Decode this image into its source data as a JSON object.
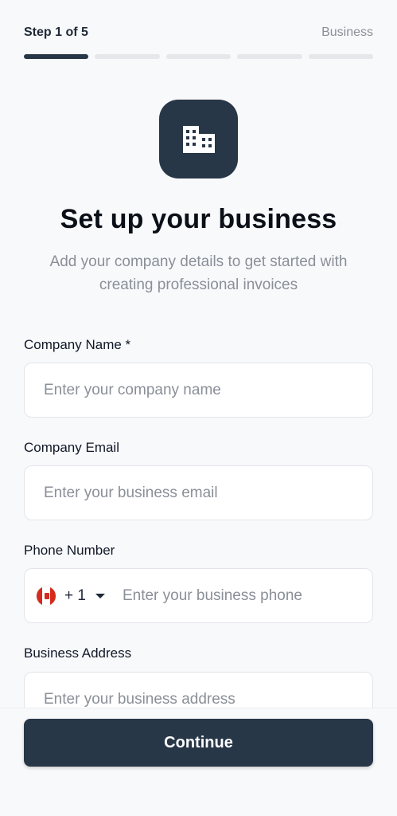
{
  "header": {
    "step_label": "Step 1 of 5",
    "step_name": "Business",
    "progress": {
      "current": 1,
      "total": 5
    }
  },
  "hero": {
    "icon": "building-icon",
    "title": "Set up your business",
    "subtitle": "Add your company details to get started with creating professional invoices"
  },
  "form": {
    "company_name": {
      "label": "Company Name *",
      "placeholder": "Enter your company name"
    },
    "company_email": {
      "label": "Company Email",
      "placeholder": "Enter your business email"
    },
    "phone": {
      "label": "Phone Number",
      "country_code": "+ 1",
      "placeholder": "Enter your business phone",
      "flag": "canada-flag-icon"
    },
    "address": {
      "label": "Business Address",
      "placeholder": "Enter your business address"
    }
  },
  "footer": {
    "continue_label": "Continue"
  },
  "colors": {
    "primary": "#283747",
    "muted": "#8a8f98",
    "background": "#f8f9fb"
  }
}
